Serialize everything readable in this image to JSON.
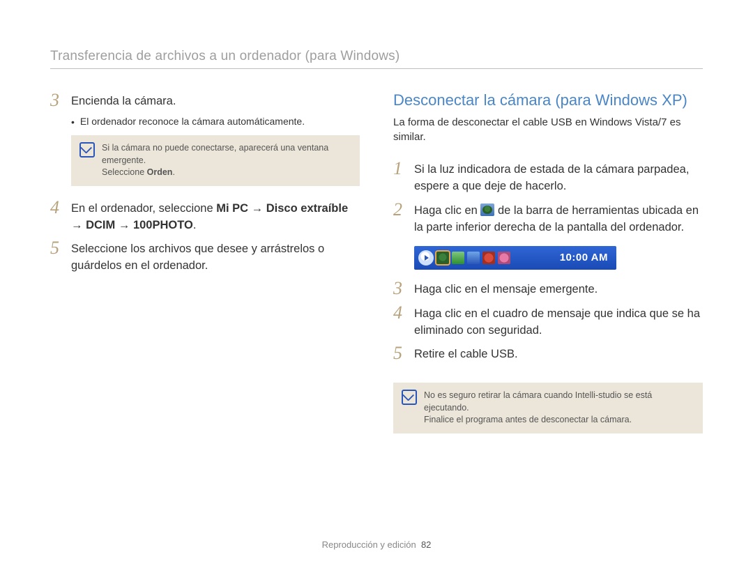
{
  "header": {
    "title": "Transferencia de archivos a un ordenador (para Windows)"
  },
  "left": {
    "step3": {
      "num": "3",
      "text": "Encienda la cámara."
    },
    "step3_bullet": "El ordenador reconoce la cámara automáticamente.",
    "note": {
      "line1": "Si la cámara no puede conectarse, aparecerá una ventana emergente.",
      "line2a": "Seleccione ",
      "line2b": "Orden",
      "line2c": "."
    },
    "step4": {
      "num": "4",
      "pre": "En el ordenador, seleccione ",
      "b1": "Mi PC",
      "arrow": " → ",
      "b2": "Disco extraíble",
      "b3": "DCIM",
      "b4": "100PHOTO",
      "dot": "."
    },
    "step5": {
      "num": "5",
      "text": "Seleccione los archivos que desee y arrástrelos o guárdelos en el ordenador."
    }
  },
  "right": {
    "title": "Desconectar la cámara (para Windows XP)",
    "subtitle": "La forma de desconectar el cable USB en Windows Vista/7 es similar.",
    "step1": {
      "num": "1",
      "text": "Si la luz indicadora de estada de la cámara parpadea, espere a que deje de hacerlo."
    },
    "step2": {
      "num": "2",
      "pre": "Haga clic en ",
      "post": " de la barra de herramientas ubicada en la parte inferior derecha de la pantalla del ordenador."
    },
    "taskbar": {
      "clock": "10:00 AM"
    },
    "step3": {
      "num": "3",
      "text": "Haga clic en el mensaje emergente."
    },
    "step4": {
      "num": "4",
      "text": "Haga clic en el cuadro de mensaje que indica que se ha eliminado con seguridad."
    },
    "step5": {
      "num": "5",
      "text": "Retire el cable USB."
    },
    "note": {
      "line1": "No es seguro retirar la cámara cuando Intelli-studio se está ejecutando.",
      "line2": "Finalice el programa antes de desconectar la cámara."
    }
  },
  "footer": {
    "section": "Reproducción y edición",
    "page": "82"
  }
}
